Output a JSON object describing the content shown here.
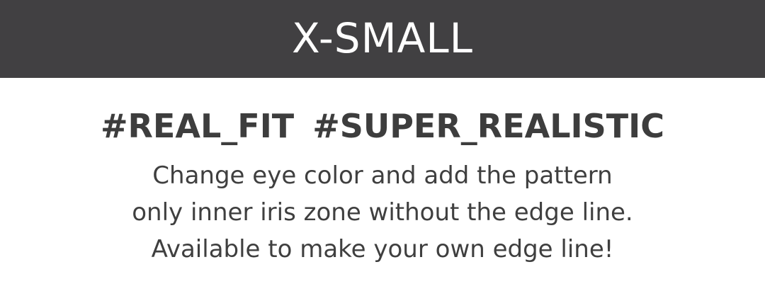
{
  "header": {
    "title": "X-SMALL",
    "background_color": "#414042"
  },
  "hashtags": [
    "#REAL_FIT",
    "#SUPER_REALISTIC"
  ],
  "description": {
    "lines": [
      "Change eye color and add the pattern",
      "only inner iris zone without the edge line.",
      "Available to make your own edge line!"
    ]
  }
}
